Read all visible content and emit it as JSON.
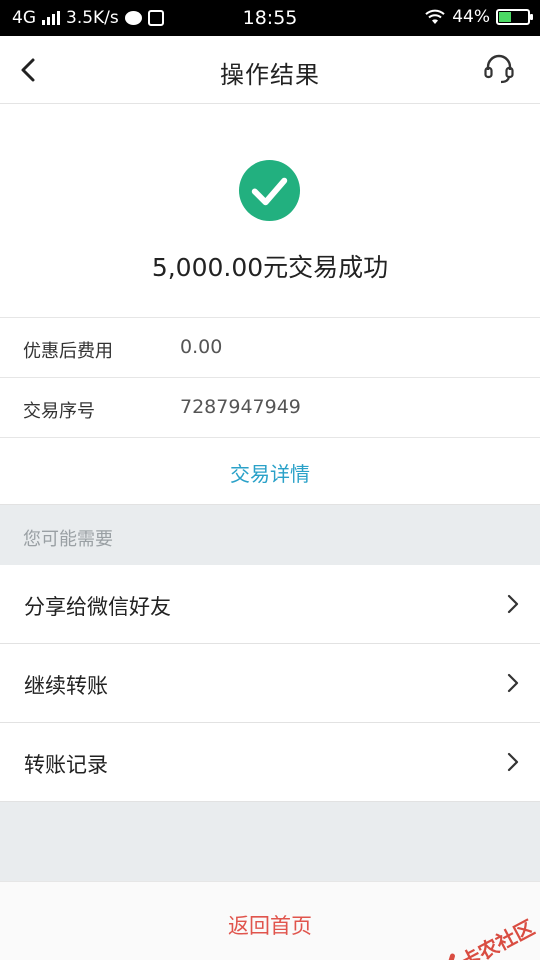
{
  "status_bar": {
    "network": "4G",
    "speed": "3.5K/s",
    "time": "18:55",
    "battery": "44%",
    "battery_level": 0.44
  },
  "nav": {
    "title": "操作结果"
  },
  "result": {
    "message": "5,000.00元交易成功",
    "accent_color": "#22b07f"
  },
  "info_rows": [
    {
      "label": "优惠后费用",
      "value": "0.00"
    },
    {
      "label": "交易序号",
      "value": "7287947949"
    }
  ],
  "detail_link": "交易详情",
  "section_title": "您可能需要",
  "actions": [
    {
      "label": "分享给微信好友"
    },
    {
      "label": "继续转账"
    },
    {
      "label": "转账记录"
    }
  ],
  "bottom": {
    "home_label": "返回首页"
  },
  "watermark": "卡农社区"
}
